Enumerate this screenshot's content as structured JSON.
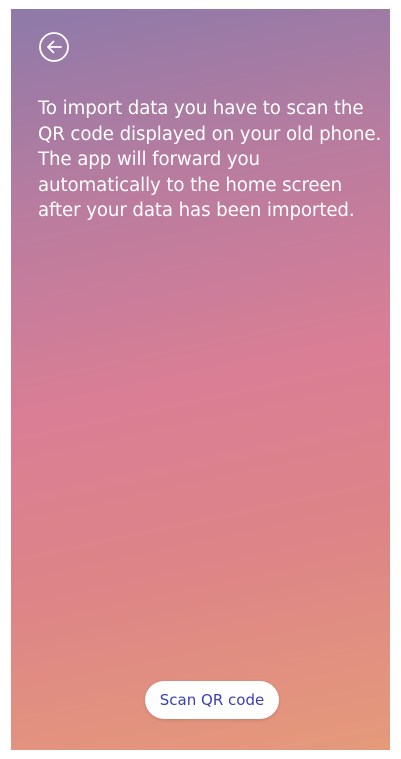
{
  "screen": {
    "back_icon": "arrow-left-circle-icon",
    "message": "To import data you have to scan the QR code displayed on your old phone. The app will forward you automatically to the home screen after your data has been imported.",
    "scan_button_label": "Scan QR code"
  },
  "colors": {
    "gradient_top": "#8d7aa9",
    "gradient_middle": "#d97e95",
    "gradient_bottom": "#e59a7a",
    "text": "#ffffff",
    "button_background": "#ffffff",
    "button_text": "#3a3fb0"
  }
}
